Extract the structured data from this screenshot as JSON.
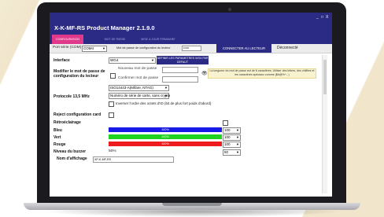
{
  "app": {
    "title": "X-K-MF-RS  Product Manager 2.1.9.0",
    "window_controls": [
      "_",
      "□",
      "X"
    ]
  },
  "tabs": [
    {
      "label": "CONFIGURATION",
      "active": true
    },
    {
      "label": "MOT DE PASSE",
      "active": false
    },
    {
      "label": "MISE À JOUR FIRMWARE",
      "active": false
    }
  ],
  "connection": {
    "port_label": "Port série (COM)",
    "port_value": "COM4",
    "password_label": "Mot de passe de configuration du lecteur",
    "password_value": "••••••",
    "connect_button": "CONNECTER AU LECTEUR",
    "status": "Déconnecté"
  },
  "interface": {
    "label": "Interface",
    "value": "WG4",
    "default_button": "DEFINIR LES PARAMETRES WG4 PAR DEFAUT"
  },
  "password_change": {
    "label": "Modifier le mot de passe de configuration du lecteur",
    "new_placeholder": "Nouveau mot de passe",
    "confirm_placeholder": "Confirmer mot de passe",
    "info": "La longueur du mot de passe est de 6 caractères. Utiliser des lettres, des chiffres et les caractères spéciaux comme ($#@%^...)"
  },
  "protocol": {
    "label": "Protocole 13,5 MHz",
    "standard_value": "ISO14443-A(Mifare, NTAG)",
    "mode_value": "Numéro de série de carte, sans crypta",
    "invert_label": "Inverser l'ordre des octets d'ID (bit de plus fort poids d'abord)"
  },
  "reject_label": "Reject configuration card",
  "backlight": {
    "label": "Rétroéclairage",
    "colors": {
      "blue": "#1a1ae6",
      "green": "#1fd21f",
      "red": "#ee1c1c"
    },
    "rows": [
      {
        "label": "Bleu",
        "bar_text": "100%",
        "value": "100",
        "level": 1.0
      },
      {
        "label": "Vert",
        "bar_text": "100%",
        "value": "100",
        "level": 1.0
      },
      {
        "label": "Rouge",
        "bar_text": "100%",
        "value": "100",
        "level": 1.0
      }
    ]
  },
  "buzzer": {
    "label": "Niveau du buzzer",
    "text": "50%",
    "value": "50"
  },
  "display_name": {
    "label": "Nom d'affichage",
    "value": "XP-K-MF-RS"
  }
}
